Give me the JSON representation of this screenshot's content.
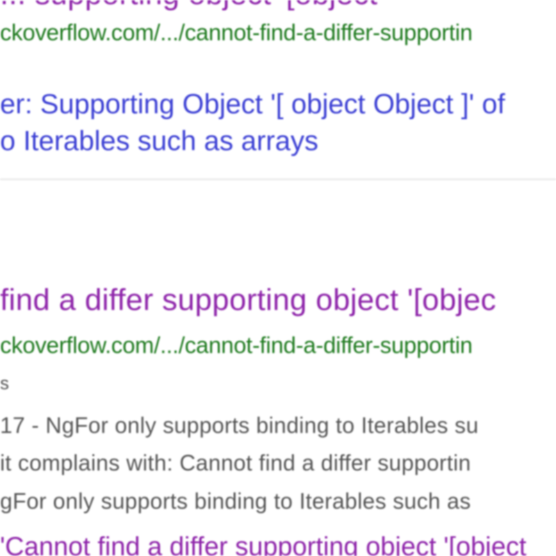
{
  "result1": {
    "title": "... supporting object '[object",
    "url": "ckoverflow.com/.../cannot-find-a-differ-supportin",
    "sublinks": [
      "er: Supporting Object '[ object Object ]' of",
      "o Iterables such as arrays"
    ]
  },
  "result2": {
    "title": "find a differ supporting object '[objec",
    "url": "ckoverflow.com/.../cannot-find-a-differ-supportin",
    "snippet_meta": "s",
    "snippet": [
      "17 - NgFor only supports binding to Iterables su",
      "it complains with: Cannot find a differ supportin",
      "gFor only supports binding to Iterables such as"
    ],
    "next_link": "'Cannot find a differ supporting object '[object"
  },
  "colors": {
    "visited_title": "#8e24aa",
    "url_green": "#1e7a1e",
    "link_blue": "#3b3fd4",
    "snippet_gray": "#555555"
  }
}
